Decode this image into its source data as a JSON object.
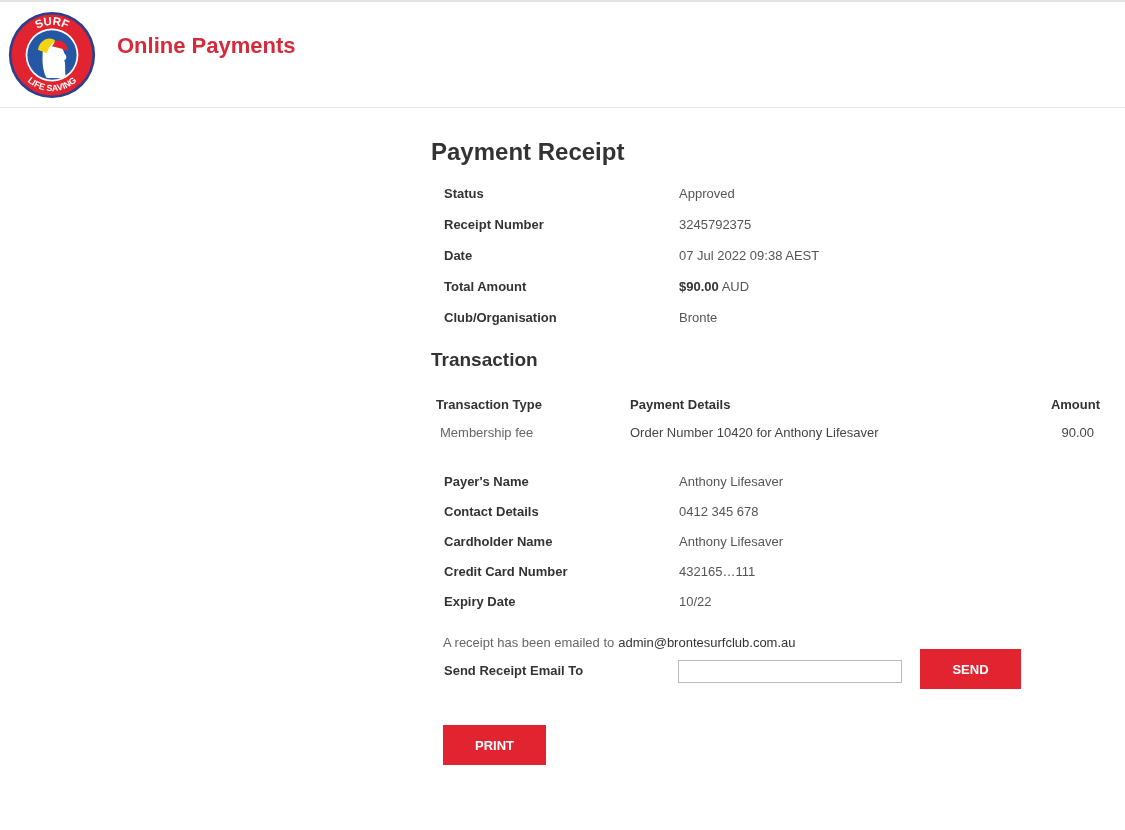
{
  "header": {
    "logo": {
      "top_text": "SURF",
      "bottom_text": "LIFE SAVING"
    },
    "title": "Online Payments"
  },
  "receipt": {
    "title": "Payment Receipt",
    "summary": [
      {
        "label": "Status",
        "value": "Approved"
      },
      {
        "label": "Receipt Number",
        "value": "3245792375"
      },
      {
        "label": "Date",
        "value": "07 Jul 2022 09:38 AEST"
      },
      {
        "label": "Total Amount",
        "value": "**$90.00** AUD"
      },
      {
        "label": "Club/Organisation",
        "value": "Bronte"
      }
    ],
    "transaction": {
      "title": "Transaction",
      "columns": [
        "Transaction Type",
        "Payment Details",
        "Amount"
      ],
      "rows": [
        [
          "Membership fee",
          "Order Number 10420 for Anthony Lifesaver",
          "90.00"
        ]
      ]
    },
    "details": [
      {
        "label": "Payer's Name",
        "value": "Anthony Lifesaver"
      },
      {
        "label": "Contact Details",
        "value": "0412 345 678"
      },
      {
        "label": "Cardholder Name",
        "value": "Anthony Lifesaver"
      },
      {
        "label": "Credit Card Number",
        "value": "432165…111"
      },
      {
        "label": "Expiry Date",
        "value": "10/22"
      }
    ],
    "emailed_note": {
      "text": "A receipt has been emailed to",
      "email": "admin@brontesurfclub.com.au"
    },
    "send_form": {
      "label": "Send Receipt Email To",
      "button": "SEND"
    },
    "print_button": "PRINT"
  }
}
